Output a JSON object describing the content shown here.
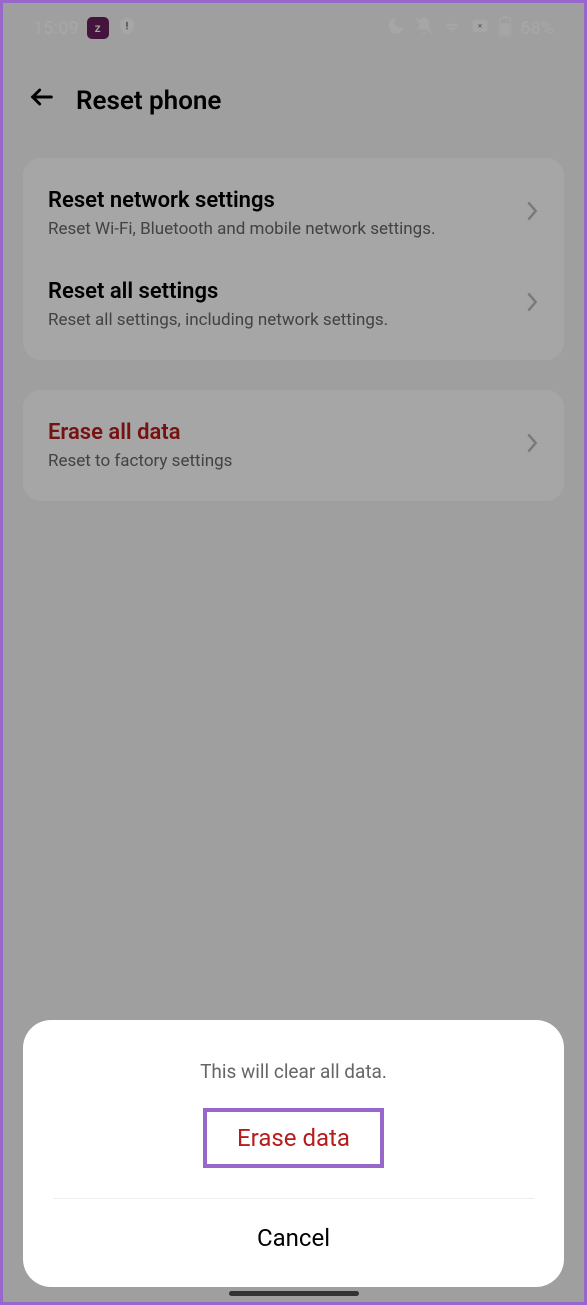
{
  "statusBar": {
    "time": "15:09",
    "battery": "68%"
  },
  "header": {
    "title": "Reset phone"
  },
  "sections": [
    {
      "items": [
        {
          "title": "Reset network settings",
          "subtitle": "Reset Wi-Fi, Bluetooth and mobile network settings."
        },
        {
          "title": "Reset all settings",
          "subtitle": "Reset all settings, including network settings."
        }
      ]
    },
    {
      "items": [
        {
          "title": "Erase all data",
          "subtitle": "Reset to factory settings",
          "danger": true
        }
      ]
    }
  ],
  "dialog": {
    "message": "This will clear all data.",
    "confirm": "Erase data",
    "cancel": "Cancel"
  }
}
